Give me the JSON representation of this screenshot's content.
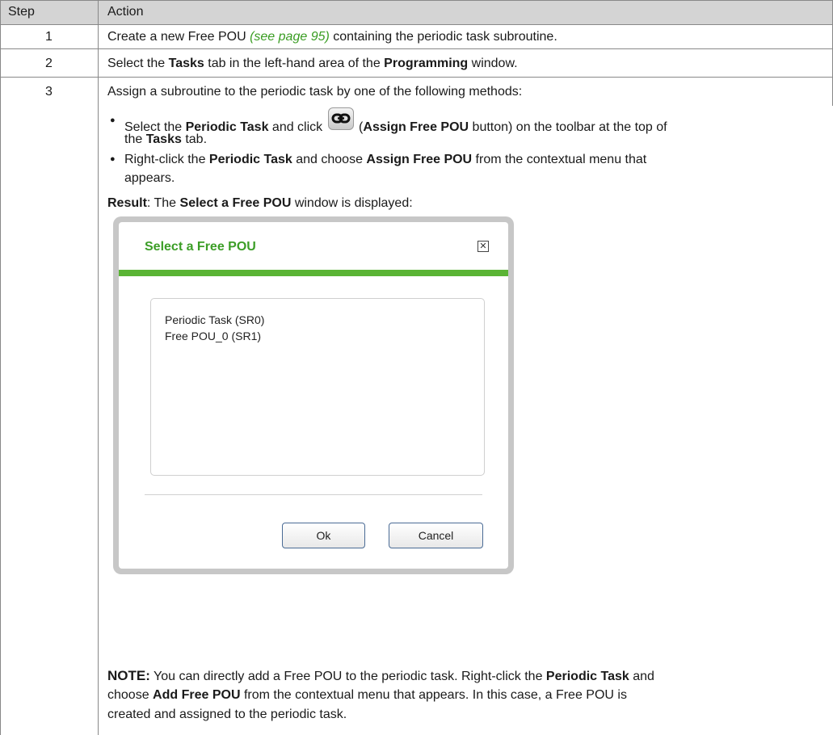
{
  "table": {
    "headers": {
      "step": "Step",
      "action": "Action"
    },
    "rows": [
      {
        "step": "1",
        "parts": [
          "Create a new Free POU ",
          "(see page 95)",
          " containing the periodic task subroutine."
        ]
      },
      {
        "step": "2",
        "parts": [
          "Select the ",
          "Tasks",
          " tab in the left-hand area of the ",
          "Programming",
          " window."
        ]
      },
      {
        "step": "3",
        "intro": "Assign a subroutine to the periodic task by one of the following methods:",
        "bullet1": {
          "a": "Select the ",
          "b": "Periodic Task",
          "c": " and click ",
          "d": " (",
          "e": "Assign Free POU",
          "f": " button) on the toolbar at the top of",
          "g": "the ",
          "h": "Tasks",
          "i": " tab."
        },
        "bullet2": {
          "a": "Right-click the ",
          "b": "Periodic Task",
          "c": " and choose ",
          "d": "Assign Free POU",
          "e": " from the contextual menu that",
          "f": "appears."
        },
        "result": {
          "a": "Result",
          "b": ": The ",
          "c": "Select a Free POU",
          "d": " window is displayed:"
        },
        "note": {
          "label": "NOTE:",
          "l1a": " You can directly add a Free POU to the periodic task. Right-click the ",
          "l1b": "Periodic Task",
          "l1c": " and",
          "l2a": "choose ",
          "l2b": "Add Free POU",
          "l2c": " from the contextual menu that appears. In this case, a Free POU is",
          "l3": "created and assigned to the periodic task."
        }
      }
    ]
  },
  "dialog": {
    "title": "Select a Free POU",
    "close_glyph": "✕",
    "items": [
      "Periodic Task (SR0)",
      "Free POU_0 (SR1)"
    ],
    "ok_label": "Ok",
    "cancel_label": "Cancel"
  },
  "icons": {
    "assign_free_pou": "link-icon"
  },
  "colors": {
    "link": "#3a9d23",
    "dialog_title": "#3c9e27",
    "dialog_bar": "#5ab434",
    "header_bg": "#d4d4d4"
  }
}
